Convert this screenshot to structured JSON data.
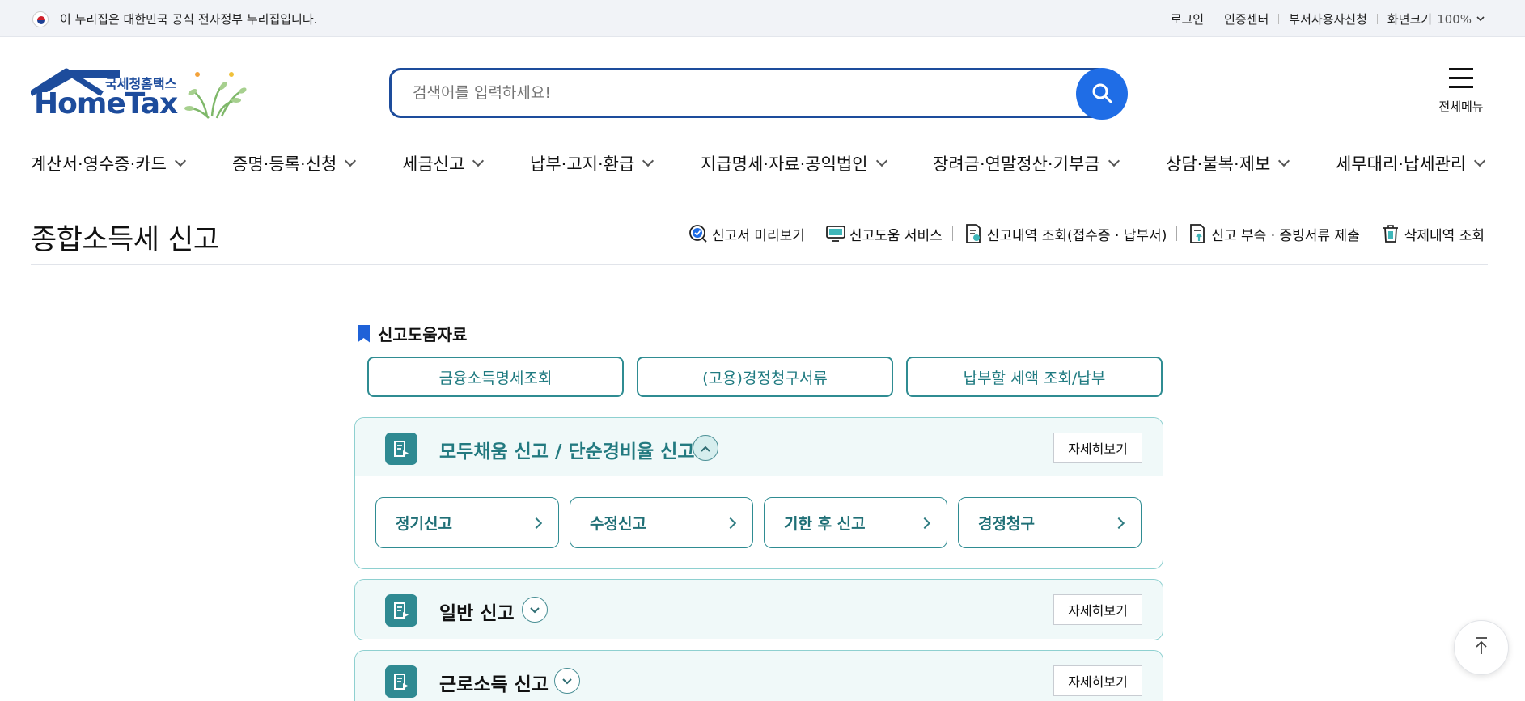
{
  "gov_bar": {
    "notice": "이 누리집은 대한민국 공식 전자정부 누리집입니다.",
    "links": [
      "로그인",
      "인증센터",
      "부서사용자신청"
    ],
    "zoom_label": "화면크기",
    "zoom_value": "100%"
  },
  "header": {
    "logo_sub": "국세청홈택스",
    "logo_main": "HomeTax",
    "search_placeholder": "검색어를 입력하세요!",
    "all_menu_label": "전체메뉴"
  },
  "nav": {
    "items": [
      "계산서·영수증·카드",
      "증명·등록·신청",
      "세금신고",
      "납부·고지·환급",
      "지급명세·자료·공익법인",
      "장려금·연말정산·기부금",
      "상담·불복·제보",
      "세무대리·납세관리"
    ]
  },
  "page": {
    "title": "종합소득세 신고",
    "utility": [
      "신고서 미리보기",
      "신고도움 서비스",
      "신고내역 조회(접수증 · 납부서)",
      "신고 부속 · 증빙서류 제출",
      "삭제내역 조회"
    ]
  },
  "help": {
    "title": "신고도움자료",
    "buttons": [
      "금융소득명세조회",
      "(고용)경정청구서류",
      "납부할 세액 조회/납부"
    ]
  },
  "panels": [
    {
      "title": "모두채움 신고 / 단순경비율 신고",
      "detail_label": "자세히보기",
      "expanded": true,
      "sub_buttons": [
        "정기신고",
        "수정신고",
        "기한 후 신고",
        "경정청구"
      ]
    },
    {
      "title": "일반 신고",
      "detail_label": "자세히보기",
      "expanded": false
    },
    {
      "title": "근로소득 신고",
      "detail_label": "자세히보기",
      "expanded": false
    }
  ],
  "colors": {
    "brand_blue": "#1d4c9c",
    "search_button": "#1f6de6",
    "teal": "#2f8c92",
    "panel_bg": "#f0f9f9"
  }
}
